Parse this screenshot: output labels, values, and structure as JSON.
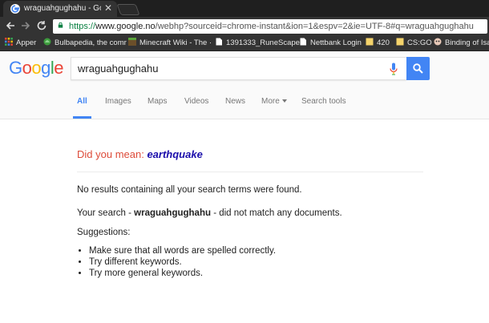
{
  "browser": {
    "tab_title": "wraguahgughahu - Goog",
    "tab_close": "✕",
    "url_scheme": "https://",
    "url_host": "www.google.no",
    "url_path": "/webhp?sourceid=chrome-instant&ion=1&espv=2&ie=UTF-8#q=wraguahgughahu",
    "bookmarks": [
      {
        "label": "Apper",
        "icon": "apps-grid-icon"
      },
      {
        "label": "Bulbapedia, the comr",
        "icon": "bulbapedia-icon"
      },
      {
        "label": "Minecraft Wiki - The ·",
        "icon": "minecraft-icon"
      },
      {
        "label": "1391333_RuneScape",
        "icon": "page-icon"
      },
      {
        "label": "Nettbank Login",
        "icon": "page-icon"
      },
      {
        "label": "420",
        "icon": "folder-icon"
      },
      {
        "label": "CS:GO",
        "icon": "folder-icon"
      },
      {
        "label": "Binding of Isaa",
        "icon": "isaac-icon"
      }
    ]
  },
  "search": {
    "query": "wraguahgughahu"
  },
  "logo": {
    "letters": [
      "G",
      "o",
      "o",
      "g",
      "l",
      "e"
    ],
    "colors": [
      "#4285f4",
      "#ea4335",
      "#fbbc05",
      "#4285f4",
      "#34a853",
      "#ea4335"
    ]
  },
  "tabs": [
    {
      "label": "All",
      "active": true
    },
    {
      "label": "Images"
    },
    {
      "label": "Maps"
    },
    {
      "label": "Videos"
    },
    {
      "label": "News"
    },
    {
      "label": "More"
    },
    {
      "label": "Search tools"
    }
  ],
  "results": {
    "did_you_mean_prefix": "Did you mean: ",
    "did_you_mean_term": "earthquake",
    "no_results": "No results containing all your search terms were found.",
    "your_search_prefix": "Your search - ",
    "your_search_term": "wraguahgughahu",
    "your_search_suffix": " - did not match any documents.",
    "suggestions_heading": "Suggestions:",
    "suggestions": [
      "Make sure that all words are spelled correctly.",
      "Try different keywords.",
      "Try more general keywords."
    ]
  }
}
